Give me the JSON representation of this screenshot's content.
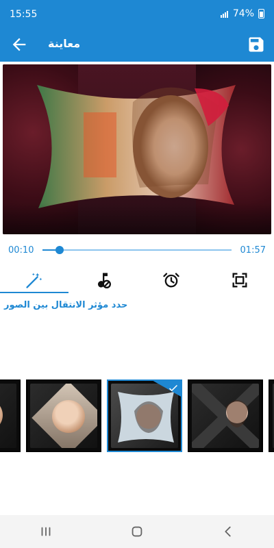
{
  "status_bar": {
    "time": "15:55",
    "battery_percent": "74%",
    "colors": {
      "bg": "#1e88d3",
      "fg": "#ffffff"
    }
  },
  "app_bar": {
    "title": "معاينة",
    "icons": {
      "back": "arrow-left-icon",
      "save": "save-icon"
    }
  },
  "preview": {
    "description_icons": [
      "video-preview"
    ]
  },
  "seek_bar": {
    "current_time": "00:10",
    "total_time": "01:57",
    "progress_fraction": 0.09,
    "accent": "#1e88d3"
  },
  "tabs": [
    {
      "name": "transition-effects",
      "icon": "magic-wand-icon",
      "active": true
    },
    {
      "name": "music",
      "icon": "music-note-icon",
      "active": false
    },
    {
      "name": "duration",
      "icon": "alarm-clock-icon",
      "active": false
    },
    {
      "name": "frame",
      "icon": "frame-icon",
      "active": false
    }
  ],
  "hint_text": "حدد مؤثر الانتقال بين الصور",
  "thumbnails": [
    {
      "name": "transition-thumb-1",
      "selected": false
    },
    {
      "name": "transition-thumb-2",
      "selected": false
    },
    {
      "name": "transition-thumb-3",
      "selected": true
    },
    {
      "name": "transition-thumb-4",
      "selected": false
    },
    {
      "name": "transition-thumb-5",
      "selected": false
    }
  ],
  "nav_bar": {
    "items": [
      {
        "name": "recent-apps",
        "icon": "recent-apps-icon"
      },
      {
        "name": "home",
        "icon": "home-icon"
      },
      {
        "name": "back",
        "icon": "back-chevron-icon"
      }
    ]
  }
}
